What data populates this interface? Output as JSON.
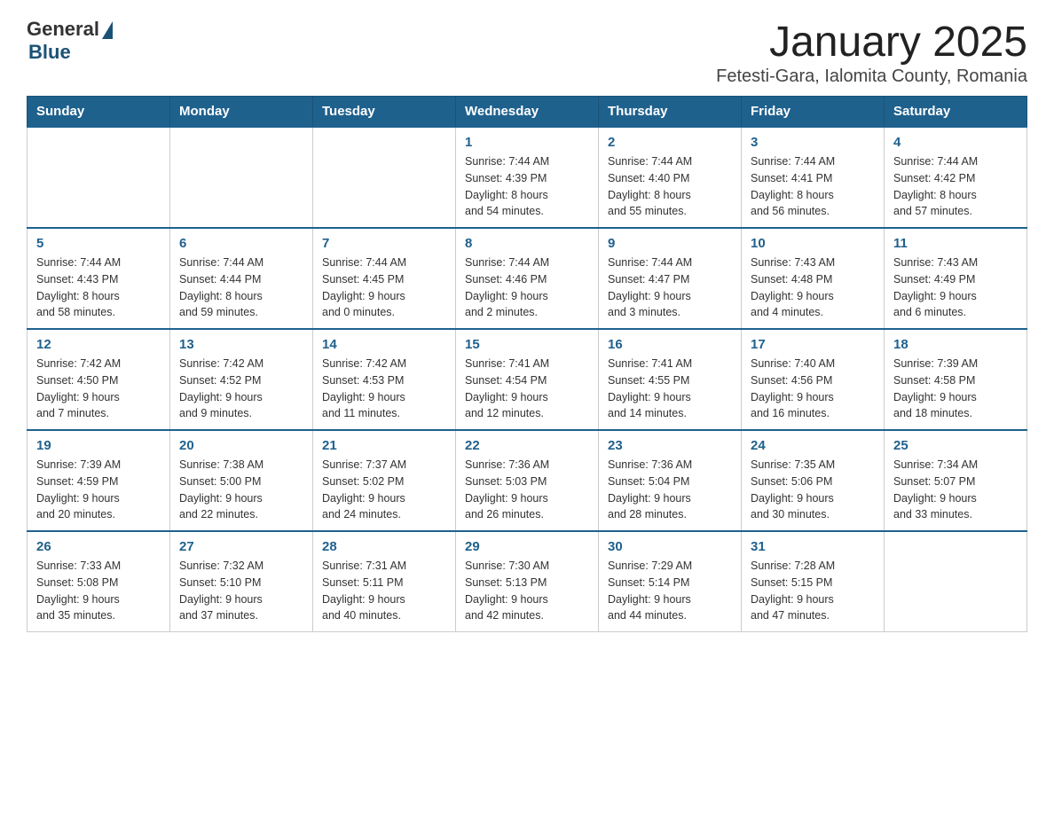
{
  "logo": {
    "general": "General",
    "blue": "Blue"
  },
  "title": "January 2025",
  "subtitle": "Fetesti-Gara, Ialomita County, Romania",
  "days_header": [
    "Sunday",
    "Monday",
    "Tuesday",
    "Wednesday",
    "Thursday",
    "Friday",
    "Saturday"
  ],
  "weeks": [
    [
      {
        "day": "",
        "info": ""
      },
      {
        "day": "",
        "info": ""
      },
      {
        "day": "",
        "info": ""
      },
      {
        "day": "1",
        "info": "Sunrise: 7:44 AM\nSunset: 4:39 PM\nDaylight: 8 hours\nand 54 minutes."
      },
      {
        "day": "2",
        "info": "Sunrise: 7:44 AM\nSunset: 4:40 PM\nDaylight: 8 hours\nand 55 minutes."
      },
      {
        "day": "3",
        "info": "Sunrise: 7:44 AM\nSunset: 4:41 PM\nDaylight: 8 hours\nand 56 minutes."
      },
      {
        "day": "4",
        "info": "Sunrise: 7:44 AM\nSunset: 4:42 PM\nDaylight: 8 hours\nand 57 minutes."
      }
    ],
    [
      {
        "day": "5",
        "info": "Sunrise: 7:44 AM\nSunset: 4:43 PM\nDaylight: 8 hours\nand 58 minutes."
      },
      {
        "day": "6",
        "info": "Sunrise: 7:44 AM\nSunset: 4:44 PM\nDaylight: 8 hours\nand 59 minutes."
      },
      {
        "day": "7",
        "info": "Sunrise: 7:44 AM\nSunset: 4:45 PM\nDaylight: 9 hours\nand 0 minutes."
      },
      {
        "day": "8",
        "info": "Sunrise: 7:44 AM\nSunset: 4:46 PM\nDaylight: 9 hours\nand 2 minutes."
      },
      {
        "day": "9",
        "info": "Sunrise: 7:44 AM\nSunset: 4:47 PM\nDaylight: 9 hours\nand 3 minutes."
      },
      {
        "day": "10",
        "info": "Sunrise: 7:43 AM\nSunset: 4:48 PM\nDaylight: 9 hours\nand 4 minutes."
      },
      {
        "day": "11",
        "info": "Sunrise: 7:43 AM\nSunset: 4:49 PM\nDaylight: 9 hours\nand 6 minutes."
      }
    ],
    [
      {
        "day": "12",
        "info": "Sunrise: 7:42 AM\nSunset: 4:50 PM\nDaylight: 9 hours\nand 7 minutes."
      },
      {
        "day": "13",
        "info": "Sunrise: 7:42 AM\nSunset: 4:52 PM\nDaylight: 9 hours\nand 9 minutes."
      },
      {
        "day": "14",
        "info": "Sunrise: 7:42 AM\nSunset: 4:53 PM\nDaylight: 9 hours\nand 11 minutes."
      },
      {
        "day": "15",
        "info": "Sunrise: 7:41 AM\nSunset: 4:54 PM\nDaylight: 9 hours\nand 12 minutes."
      },
      {
        "day": "16",
        "info": "Sunrise: 7:41 AM\nSunset: 4:55 PM\nDaylight: 9 hours\nand 14 minutes."
      },
      {
        "day": "17",
        "info": "Sunrise: 7:40 AM\nSunset: 4:56 PM\nDaylight: 9 hours\nand 16 minutes."
      },
      {
        "day": "18",
        "info": "Sunrise: 7:39 AM\nSunset: 4:58 PM\nDaylight: 9 hours\nand 18 minutes."
      }
    ],
    [
      {
        "day": "19",
        "info": "Sunrise: 7:39 AM\nSunset: 4:59 PM\nDaylight: 9 hours\nand 20 minutes."
      },
      {
        "day": "20",
        "info": "Sunrise: 7:38 AM\nSunset: 5:00 PM\nDaylight: 9 hours\nand 22 minutes."
      },
      {
        "day": "21",
        "info": "Sunrise: 7:37 AM\nSunset: 5:02 PM\nDaylight: 9 hours\nand 24 minutes."
      },
      {
        "day": "22",
        "info": "Sunrise: 7:36 AM\nSunset: 5:03 PM\nDaylight: 9 hours\nand 26 minutes."
      },
      {
        "day": "23",
        "info": "Sunrise: 7:36 AM\nSunset: 5:04 PM\nDaylight: 9 hours\nand 28 minutes."
      },
      {
        "day": "24",
        "info": "Sunrise: 7:35 AM\nSunset: 5:06 PM\nDaylight: 9 hours\nand 30 minutes."
      },
      {
        "day": "25",
        "info": "Sunrise: 7:34 AM\nSunset: 5:07 PM\nDaylight: 9 hours\nand 33 minutes."
      }
    ],
    [
      {
        "day": "26",
        "info": "Sunrise: 7:33 AM\nSunset: 5:08 PM\nDaylight: 9 hours\nand 35 minutes."
      },
      {
        "day": "27",
        "info": "Sunrise: 7:32 AM\nSunset: 5:10 PM\nDaylight: 9 hours\nand 37 minutes."
      },
      {
        "day": "28",
        "info": "Sunrise: 7:31 AM\nSunset: 5:11 PM\nDaylight: 9 hours\nand 40 minutes."
      },
      {
        "day": "29",
        "info": "Sunrise: 7:30 AM\nSunset: 5:13 PM\nDaylight: 9 hours\nand 42 minutes."
      },
      {
        "day": "30",
        "info": "Sunrise: 7:29 AM\nSunset: 5:14 PM\nDaylight: 9 hours\nand 44 minutes."
      },
      {
        "day": "31",
        "info": "Sunrise: 7:28 AM\nSunset: 5:15 PM\nDaylight: 9 hours\nand 47 minutes."
      },
      {
        "day": "",
        "info": ""
      }
    ]
  ]
}
